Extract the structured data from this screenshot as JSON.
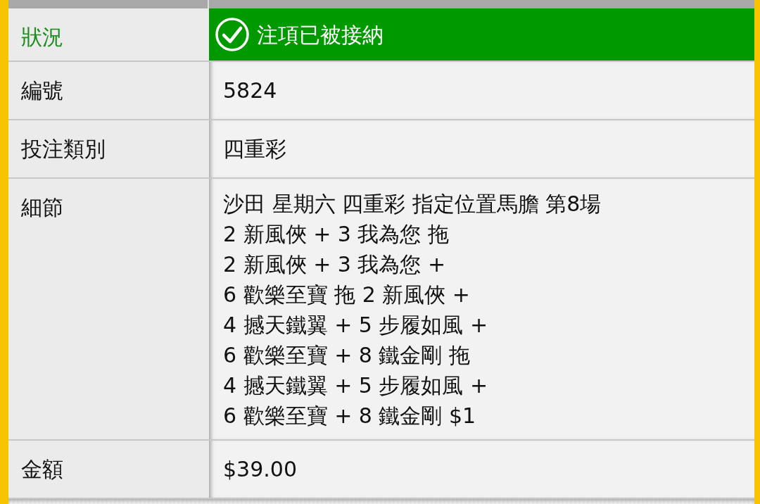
{
  "rows": [
    {
      "kind": "status",
      "label": "狀況",
      "value": "注項已被接納"
    },
    {
      "kind": "text",
      "label": "編號",
      "value": "5824"
    },
    {
      "kind": "text",
      "label": "投注類別",
      "value": "四重彩"
    },
    {
      "kind": "lines",
      "label": "細節",
      "lines": [
        "沙田 星期六 四重彩 指定位置馬膽 第8場",
        "2 新風俠 + 3 我為您 拖",
        "2 新風俠 + 3 我為您 +",
        "6 歡樂至寶 拖 2 新風俠 +",
        "4 撼天鐵翼 + 5 步履如風 +",
        "6 歡樂至寶 + 8 鐵金剛 拖",
        "4 撼天鐵翼 + 5 步履如風 +",
        "6 歡樂至寶 + 8 鐵金剛 $1"
      ]
    },
    {
      "kind": "text",
      "label": "金額",
      "value": "$39.00"
    }
  ]
}
